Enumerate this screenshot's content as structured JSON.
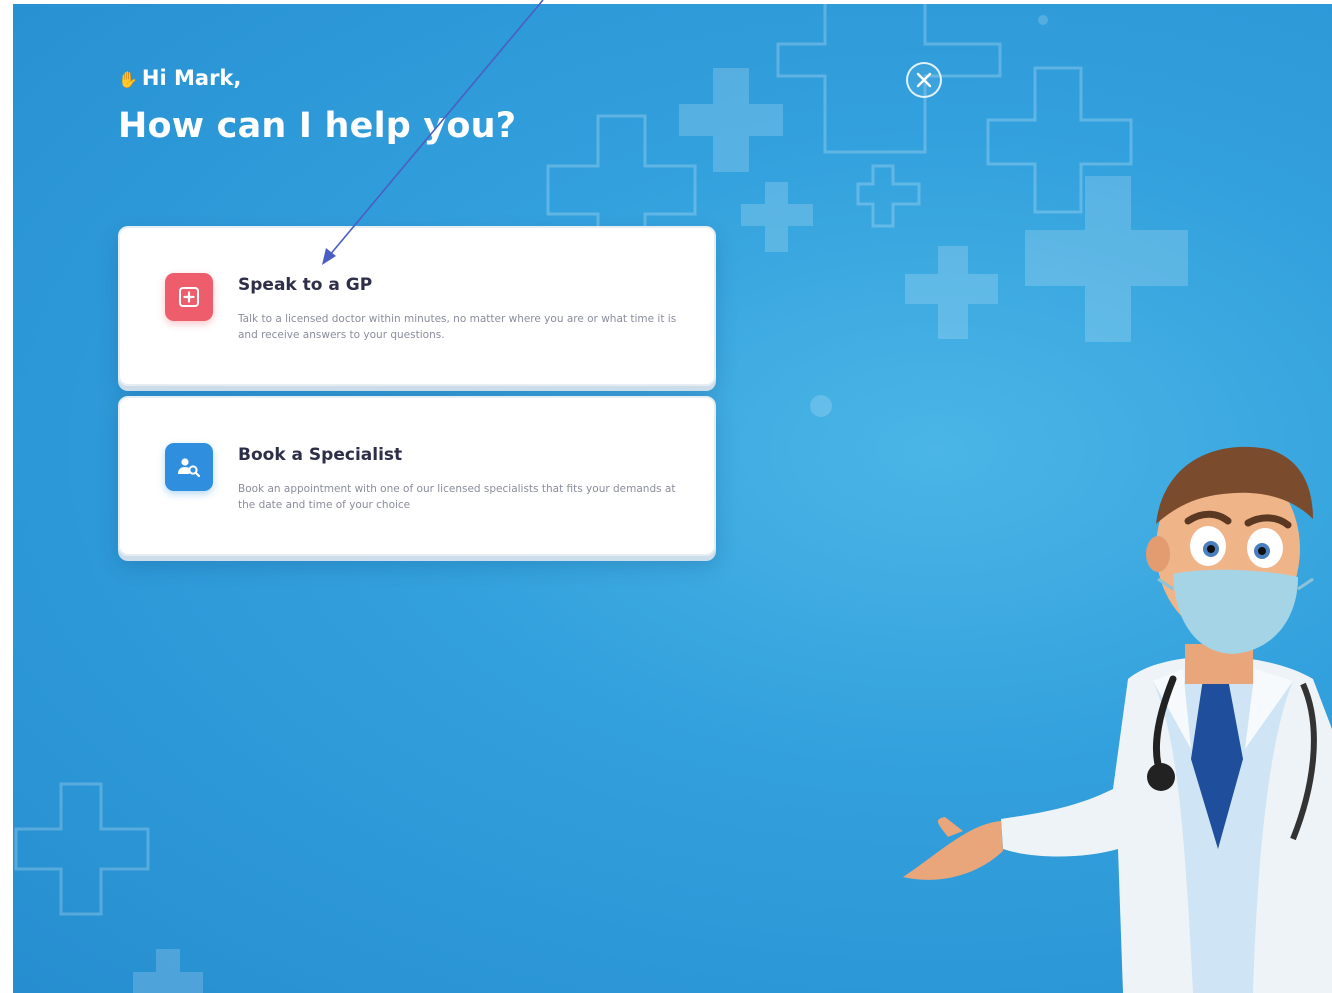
{
  "greeting": {
    "wave_icon": "waving-hand-icon",
    "text": "Hi Mark,"
  },
  "title": "How can I help you?",
  "close_button": {
    "icon": "close-icon"
  },
  "options": [
    {
      "icon": "medical-plus-icon",
      "icon_color": "#ee5d6c",
      "title": "Speak to a GP",
      "description": "Talk to a licensed doctor within minutes, no matter where you are or what time it is and receive answers to your questions."
    },
    {
      "icon": "person-search-icon",
      "icon_color": "#2f8fde",
      "title": "Book a Specialist",
      "description": "Book an appointment with one of our licensed specialists that fits your demands at the date and time of your choice"
    }
  ],
  "colors": {
    "background": "#33a1dd",
    "text_dark": "#2d2e48",
    "annotation_arrow": "#4a5fc1"
  }
}
